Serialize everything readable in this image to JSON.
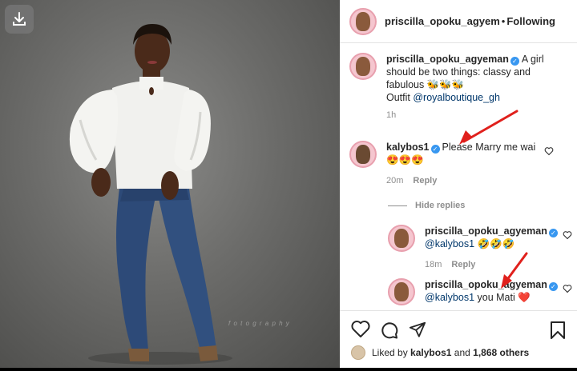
{
  "header": {
    "username": "priscilla_opoku_agyem",
    "separator": "•",
    "follow_status": "Following"
  },
  "caption": {
    "username": "priscilla_opoku_agyeman",
    "text1": "A girl should be two things: classy and fabulous",
    "emoji": "🐝🐝🐝",
    "outfit_label": "Outfit",
    "outfit_link": "@royalboutique_gh",
    "time": "1h"
  },
  "comment1": {
    "username": "kalybos1",
    "text": "Please Marry me wai",
    "emoji": "😍😍😍",
    "time": "20m",
    "reply_label": "Reply"
  },
  "hide_replies_label": "Hide replies",
  "reply1": {
    "username": "priscilla_opoku_agyeman",
    "mention": "@kalybos1",
    "emoji": "🤣🤣🤣",
    "time": "18m",
    "reply_label": "Reply"
  },
  "reply2": {
    "username": "priscilla_opoku_agyeman",
    "mention": "@kalybos1",
    "text": "you Mati",
    "emoji": "❤️"
  },
  "likes": {
    "prefix": "Liked by",
    "user": "kalybos1",
    "middle": "and",
    "count": "1,868 others"
  },
  "photo": {
    "watermark": "f o t o g r a p h y"
  },
  "icons": {
    "download": "download-icon",
    "heart": "heart-icon",
    "comment": "comment-icon",
    "share": "share-icon",
    "save": "bookmark-icon",
    "verified": "verified-badge-icon"
  },
  "colors": {
    "verified": "#3897f0",
    "arrow": "#e0201c",
    "link": "#00376b"
  }
}
